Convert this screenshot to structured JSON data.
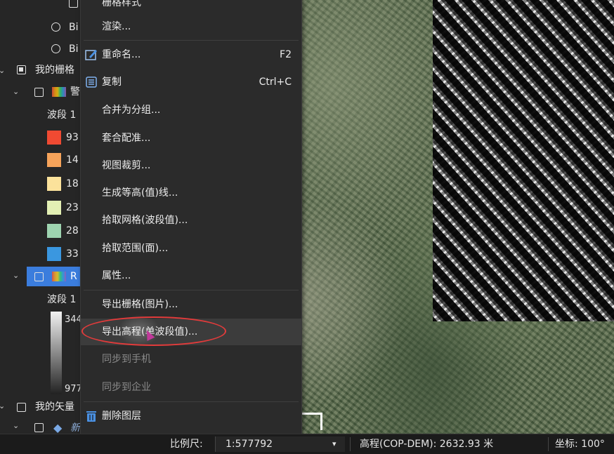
{
  "layer_tree": {
    "items": [
      {
        "label": "Bi",
        "type": "radio"
      },
      {
        "label": "Bi",
        "type": "radio"
      },
      {
        "label": "我的栅格",
        "type": "group"
      },
      {
        "label": "警",
        "type": "layer"
      },
      {
        "label": "波段 1",
        "type": "legend-title"
      },
      {
        "label": "93",
        "color": "#f04a32"
      },
      {
        "label": "14",
        "color": "#f6a35a"
      },
      {
        "label": "18",
        "color": "#fbe29b"
      },
      {
        "label": "23",
        "color": "#e3f0b4"
      },
      {
        "label": "28",
        "color": "#9ed4b0"
      },
      {
        "label": "33",
        "color": "#3a97e0"
      },
      {
        "label": "R",
        "type": "layer-selected"
      },
      {
        "label": "波段 1",
        "type": "legend-title"
      },
      {
        "label": "344",
        "type": "gradient-max"
      },
      {
        "label": "977",
        "type": "gradient-min"
      },
      {
        "label": "我的矢量",
        "type": "group"
      },
      {
        "label": "新建矢量",
        "type": "layer"
      }
    ]
  },
  "context_menu": {
    "items": [
      {
        "label": "栅格样式",
        "shortcut": ""
      },
      {
        "label": "渲染...",
        "shortcut": ""
      },
      {
        "label": "重命名...",
        "shortcut": "F2",
        "icon": "rename-icon"
      },
      {
        "label": "复制",
        "shortcut": "Ctrl+C",
        "icon": "copy-icon"
      },
      {
        "label": "合并为分组...",
        "shortcut": ""
      },
      {
        "label": "套合配准...",
        "shortcut": ""
      },
      {
        "label": "视图裁剪...",
        "shortcut": ""
      },
      {
        "label": "生成等高(值)线...",
        "shortcut": ""
      },
      {
        "label": "拾取网格(波段值)...",
        "shortcut": ""
      },
      {
        "label": "拾取范围(面)...",
        "shortcut": ""
      },
      {
        "label": "属性...",
        "shortcut": ""
      },
      {
        "label": "导出栅格(图片)...",
        "shortcut": ""
      },
      {
        "label": "导出高程(单波段值)...",
        "shortcut": "",
        "highlighted": true
      },
      {
        "label": "同步到手机",
        "shortcut": "",
        "disabled": true
      },
      {
        "label": "同步到企业",
        "shortcut": "",
        "disabled": true
      },
      {
        "label": "删除图层",
        "shortcut": "",
        "icon": "trash-icon"
      }
    ]
  },
  "status_bar": {
    "scale_label": "比例尺:",
    "scale_value": "1:577792",
    "elevation": "高程(COP-DEM):  2632.93 米",
    "coordinate": "坐标:  100°"
  }
}
